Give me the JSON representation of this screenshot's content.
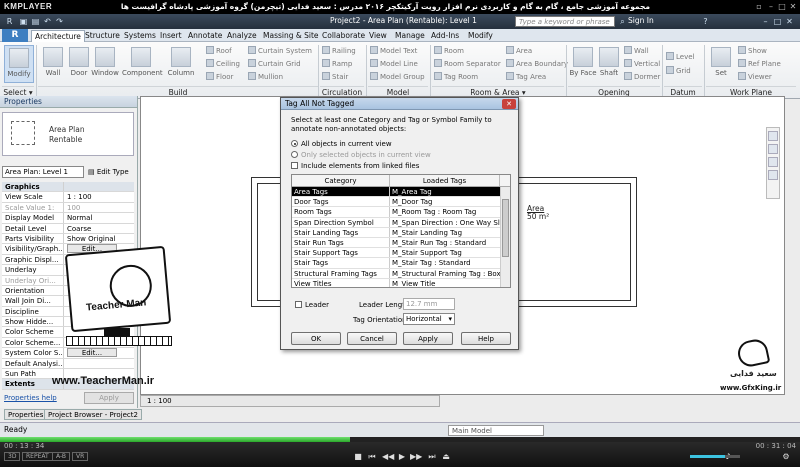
{
  "player": {
    "logo": "KMPLAYER",
    "video_title": "مجموعه آموزشی جامع ، گام به گام و کاربردی نرم افزار رویت آرکیتکچر ۲۰۱۶ مدرس : سعید فدایی (تیچرمن) گروه آموزشی پادشاه گرافیست ها",
    "time_elapsed": "00 : 13 : 34",
    "time_total": "00 : 31 : 04",
    "progress": 0.437,
    "volume": 0.7,
    "pills": [
      "3D",
      "REPEAT",
      "A-B",
      "VR"
    ]
  },
  "app": {
    "title": "Project2 - Area Plan (Rentable): Level 1",
    "search_placeholder": "Type a keyword or phrase",
    "sign_in": "Sign In",
    "tabs": [
      "Architecture",
      "Structure",
      "Systems",
      "Insert",
      "Annotate",
      "Analyze",
      "Massing & Site",
      "Collaborate",
      "View",
      "Manage",
      "Add-Ins",
      "Modify"
    ],
    "active_tab": "Architecture",
    "ribbon": {
      "select_label": "Select ▾",
      "big_tools": [
        "Modify",
        "Wall",
        "Door",
        "Window",
        "Component",
        "Column",
        "Room",
        "Area",
        "Set",
        "Show"
      ],
      "small_tools": {
        "roof": "Roof",
        "ceiling": "Ceiling",
        "floor": "Floor",
        "curtain_system": "Curtain System",
        "curtain_grid": "Curtain Grid",
        "mullion": "Mullion",
        "railing": "Railing",
        "ramp": "Ramp",
        "stair": "Stair",
        "model_text": "Model Text",
        "model_line": "Model Line",
        "model_group": "Model Group",
        "room_separator": "Room Separator",
        "tag_room": "Tag Room",
        "area_boundary": "Area Boundary",
        "tag_area": "Tag Area",
        "by_face": "By Face",
        "shaft": "Shaft",
        "wall": "Wall",
        "vertical": "Vertical",
        "dormer": "Dormer",
        "level": "Level",
        "grid": "Grid",
        "ref_plane": "Ref Plane",
        "viewer": "Viewer"
      },
      "panels": [
        "Build",
        "Circulation",
        "Model",
        "Room & Area ▾",
        "Opening",
        "Datum",
        "Work Plane"
      ]
    },
    "properties": {
      "header": "Properties",
      "type_line1": "Area Plan",
      "type_line2": "Rentable",
      "instance": "Area Plan: Level 1",
      "edit_type": "Edit Type",
      "rows": [
        {
          "name": "Graphics",
          "value": "",
          "group": true
        },
        {
          "name": "View Scale",
          "value": "1 : 100"
        },
        {
          "name": "Scale Value  1:",
          "value": "100",
          "dim": true
        },
        {
          "name": "Display Model",
          "value": "Normal"
        },
        {
          "name": "Detail Level",
          "value": "Coarse"
        },
        {
          "name": "Parts Visibility",
          "value": "Show Original"
        },
        {
          "name": "Visibility/Graph...",
          "value": "Edit...",
          "button": true
        },
        {
          "name": "Graphic Displ...",
          "value": "Edit...",
          "button": true
        },
        {
          "name": "Underlay",
          "value": "None"
        },
        {
          "name": "Underlay Ori...",
          "value": "",
          "dim": true
        },
        {
          "name": "Orientation",
          "value": ""
        },
        {
          "name": "Wall Join Di...",
          "value": ""
        },
        {
          "name": "Discipline",
          "value": ""
        },
        {
          "name": "Show Hidde...",
          "value": ""
        },
        {
          "name": "Color Scheme",
          "value": ""
        },
        {
          "name": "Color Scheme...",
          "value": "<none>"
        },
        {
          "name": "System Color S...",
          "value": "Edit...",
          "button": true
        },
        {
          "name": "Default Analysi...",
          "value": ""
        },
        {
          "name": "Sun Path",
          "value": ""
        },
        {
          "name": "Extents",
          "value": "",
          "group": true
        }
      ],
      "help_link": "Properties help",
      "apply": "Apply"
    },
    "bottom_tabs": [
      "Properties",
      "Project Browser - Project2"
    ],
    "view_scale": "1 : 100",
    "status": "Ready",
    "workset": "Main Model",
    "area_label": "Area",
    "area_value": "50 m²"
  },
  "dialog": {
    "title": "Tag All Not Tagged",
    "close": "✕",
    "instruction": "Select at least one Category and Tag or Symbol Family to annotate non-annotated objects:",
    "radio_all": "All objects in current view",
    "radio_selected": "Only selected objects in current view",
    "include_linked": "Include elements from linked files",
    "columns": [
      "Category",
      "Loaded Tags"
    ],
    "rows": [
      {
        "category": "Area Tags",
        "tag": "M_Area Tag",
        "selected": true
      },
      {
        "category": "Door Tags",
        "tag": "M_Door Tag"
      },
      {
        "category": "Room Tags",
        "tag": "M_Room Tag : Room Tag"
      },
      {
        "category": "Span Direction Symbol",
        "tag": "M_Span Direction : One Way Sla"
      },
      {
        "category": "Stair Landing Tags",
        "tag": "M_Stair Landing Tag"
      },
      {
        "category": "Stair Run Tags",
        "tag": "M_Stair Run Tag : Standard"
      },
      {
        "category": "Stair Support Tags",
        "tag": "M_Stair Support Tag"
      },
      {
        "category": "Stair Tags",
        "tag": "M_Stair Tag : Standard"
      },
      {
        "category": "Structural Framing Tags",
        "tag": "M_Structural Framing Tag : Box"
      },
      {
        "category": "View Titles",
        "tag": "M_View Title"
      }
    ],
    "leader": "Leader",
    "leader_length_label": "Leader Length:",
    "leader_length": "12.7 mm",
    "orientation_label": "Tag Orientation:",
    "orientation": "Horizontal",
    "buttons": [
      "OK",
      "Cancel",
      "Apply",
      "Help"
    ]
  },
  "overlay": {
    "teacher_name": "Teacher Man",
    "teacher_url": "www.TeacherMan.ir",
    "signature": "سعید فدایی",
    "gfx_url": "www.GfxKing.ir"
  }
}
